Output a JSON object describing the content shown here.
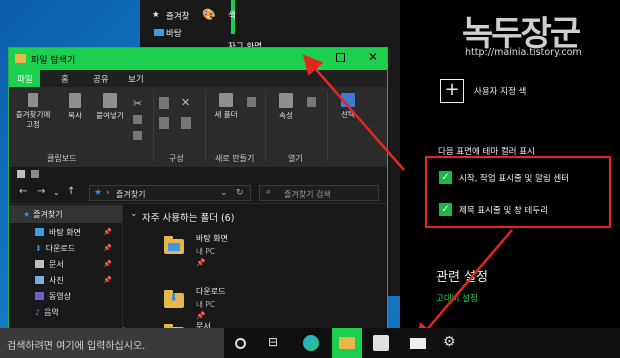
{
  "settings": {
    "side_items": [
      "즐겨찾",
      "바탕"
    ],
    "left_labels": [
      "색",
      "자그 화면"
    ],
    "custom_color_label": "사용자 지정 색",
    "show_accent_heading": "다음 표면에 테마 컬러 표시",
    "option_start": "시작, 작업 표시줄 및 알림 센터",
    "option_titlebar": "제목 표시줄 및 창 테두리",
    "related_heading": "관련 설정",
    "related_link": "고대비 설정"
  },
  "watermark": {
    "title": "녹두장군",
    "site": "http://mainia.tistory.com"
  },
  "explorer": {
    "title": "파일 탐색기",
    "tabs": [
      "파일",
      "홈",
      "공유",
      "보기"
    ],
    "ribbon": {
      "pin_label": "즐겨찾기에 고정",
      "copy_label": "복사",
      "paste_label": "붙여넣기",
      "new_folder_label": "새 폴더",
      "properties_label": "속성",
      "select_label": "선택",
      "groups": [
        "클립보드",
        "구성",
        "새로 만들기",
        "열기"
      ]
    },
    "address": "즐겨찾기",
    "search_placeholder": "즐겨찾기 검색",
    "nav_items": [
      {
        "label": "즐겨찾기",
        "color": "#2b8fe6"
      },
      {
        "label": "바탕 화면",
        "color": "#3c9be6"
      },
      {
        "label": "다운로드",
        "color": "#2b8fe6"
      },
      {
        "label": "문서",
        "color": "#bfbfbf"
      },
      {
        "label": "사진",
        "color": "#7aaee0"
      },
      {
        "label": "동영상",
        "color": "#6b5fd3"
      },
      {
        "label": "음악",
        "color": "#4f9be0"
      }
    ],
    "section_title": "자주 사용하는 폴더 (6)",
    "folders": [
      {
        "name": "바탕 화면",
        "location": "내 PC"
      },
      {
        "name": "다운로드",
        "location": "내 PC"
      },
      {
        "name": "문서",
        "location": ""
      }
    ]
  },
  "taskbar": {
    "search_placeholder": "검색하려면 여기에 입력하십시오."
  },
  "colors": {
    "accent": "#1ccf4f",
    "highlight": "#e3261f",
    "check": "#1db64a"
  }
}
